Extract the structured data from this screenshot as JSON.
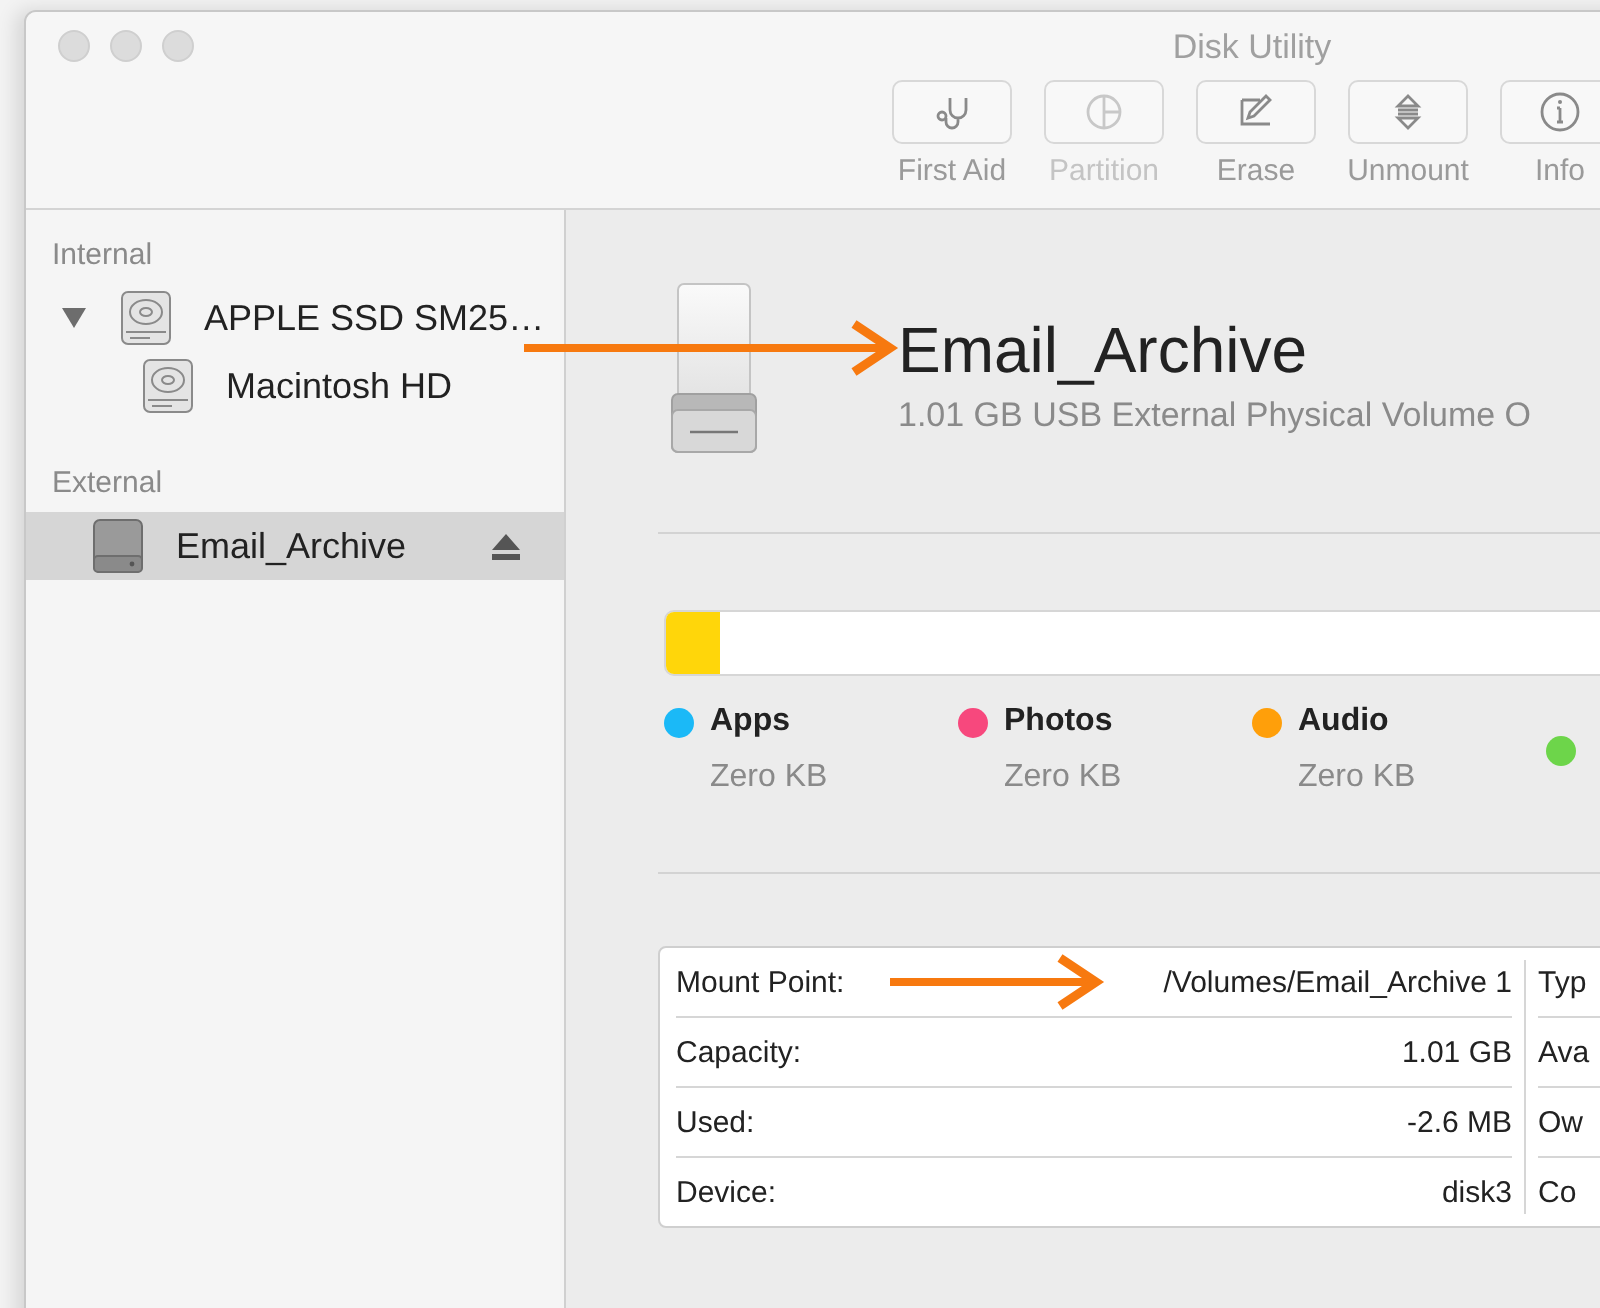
{
  "window": {
    "title": "Disk Utility"
  },
  "toolbar": [
    {
      "label": "First Aid",
      "kind": "first-aid",
      "disabled": false
    },
    {
      "label": "Partition",
      "kind": "partition",
      "disabled": true
    },
    {
      "label": "Erase",
      "kind": "erase",
      "disabled": false
    },
    {
      "label": "Unmount",
      "kind": "unmount",
      "disabled": false
    },
    {
      "label": "Info",
      "kind": "info",
      "disabled": false
    }
  ],
  "sidebar": {
    "sections": [
      {
        "title": "Internal",
        "items": [
          {
            "name": "APPLE SSD SM25…",
            "kind": "internal",
            "selected": false,
            "expanded": true,
            "ejectable": false,
            "children": [
              {
                "name": "Macintosh HD",
                "kind": "internal",
                "selected": false,
                "ejectable": false
              }
            ]
          }
        ]
      },
      {
        "title": "External",
        "items": [
          {
            "name": "Email_Archive",
            "kind": "external",
            "selected": true,
            "ejectable": true
          }
        ]
      }
    ]
  },
  "volume": {
    "name": "Email_Archive",
    "description": "1.01 GB USB External Physical Volume O"
  },
  "usage": {
    "level": 0.03,
    "color": "#ffd60a"
  },
  "legend": [
    {
      "label": "Apps",
      "value": "Zero KB",
      "color": "#1bb9f7"
    },
    {
      "label": "Photos",
      "value": "Zero KB",
      "color": "#f7487d"
    },
    {
      "label": "Audio",
      "value": "Zero KB",
      "color": "#ff9f0a"
    },
    {
      "color": "#6dd54a"
    }
  ],
  "info": {
    "left": [
      {
        "label": "Mount Point:",
        "value": "/Volumes/Email_Archive 1"
      },
      {
        "label": "Capacity:",
        "value": "1.01 GB"
      },
      {
        "label": "Used:",
        "value": "-2.6 MB"
      },
      {
        "label": "Device:",
        "value": "disk3"
      }
    ],
    "right": [
      {
        "label": "Typ"
      },
      {
        "label": "Ava"
      },
      {
        "label": "Ow"
      },
      {
        "label": "Co"
      }
    ]
  }
}
